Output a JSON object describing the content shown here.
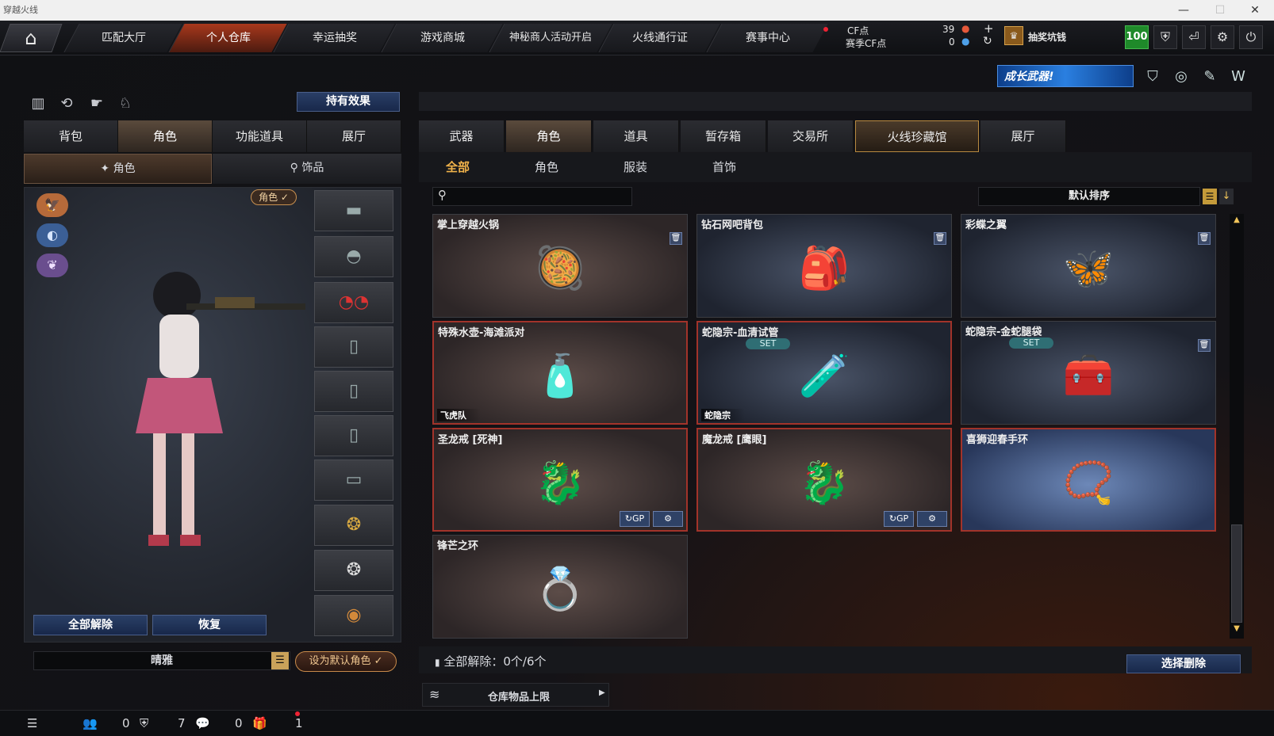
{
  "window": {
    "title": "穿越火线",
    "controls": [
      "—",
      "☐",
      "✕"
    ]
  },
  "topnav": {
    "tabs": [
      "匹配大厅",
      "个人仓库",
      "幸运抽奖",
      "游戏商城",
      "神秘商人活动开启",
      "火线通行证",
      "赛事中心"
    ],
    "active": "个人仓库",
    "cf_label": "CF点",
    "cf_value": "39",
    "season_cf_label": "赛季CF点",
    "season_cf_value": "0",
    "lottery_label": "抽奖坑钱",
    "level": "100"
  },
  "banner": {
    "text": "成长武器!"
  },
  "left": {
    "hold_effect": "持有效果",
    "tabs": [
      "背包",
      "角色",
      "功能道具",
      "展厅"
    ],
    "active_tab": "角色",
    "subtabs": [
      "角色",
      "饰品"
    ],
    "role_badge": "角色 ✓",
    "unequip_all": "全部解除",
    "restore": "恢复",
    "char_name": "晴雅",
    "set_default": "设为默认角色 ✓"
  },
  "right": {
    "tabs": [
      "武器",
      "角色",
      "道具",
      "暂存箱",
      "交易所",
      "火线珍藏馆",
      "展厅"
    ],
    "active_tab": "角色",
    "highlight_tab": "火线珍藏馆",
    "filters": [
      "全部",
      "角色",
      "服装",
      "首饰"
    ],
    "active_filter": "全部",
    "sort_label": "默认排序",
    "items": [
      {
        "name": "掌上穿越火锅",
        "icon": "🥘",
        "style": "warm",
        "trash": true
      },
      {
        "name": "钻石网吧背包",
        "icon": "🎒",
        "style": "cool",
        "trash": true
      },
      {
        "name": "彩蝶之翼",
        "icon": "🦋",
        "style": "cool",
        "trash": true
      },
      {
        "name": "特殊水壶-海滩派对",
        "icon": "🧴",
        "style": "warm red",
        "tag": "飞虎队"
      },
      {
        "name": "蛇隐宗-血清试管",
        "icon": "🧪",
        "style": "cool red",
        "set": "SET",
        "tag": "蛇隐宗"
      },
      {
        "name": "蛇隐宗-金蛇腿袋",
        "icon": "🧰",
        "style": "cool",
        "set": "SET",
        "trash": true
      },
      {
        "name": "圣龙戒 [死神]",
        "icon": "🐉",
        "style": "warm red",
        "gp": true
      },
      {
        "name": "魔龙戒 [鹰眼]",
        "icon": "🐉",
        "style": "warm red",
        "gp": true
      },
      {
        "name": "喜狮迎春手环",
        "icon": "📿",
        "style": "glow"
      },
      {
        "name": "锋芒之环",
        "icon": "💍",
        "style": "warm"
      }
    ],
    "unequip_status": "全部解除：0个/6个",
    "select_delete": "选择删除",
    "storage_limit": "仓库物品上限"
  },
  "statusbar": {
    "friends": "0",
    "clan": "7",
    "messages": "0",
    "gifts": "1"
  }
}
